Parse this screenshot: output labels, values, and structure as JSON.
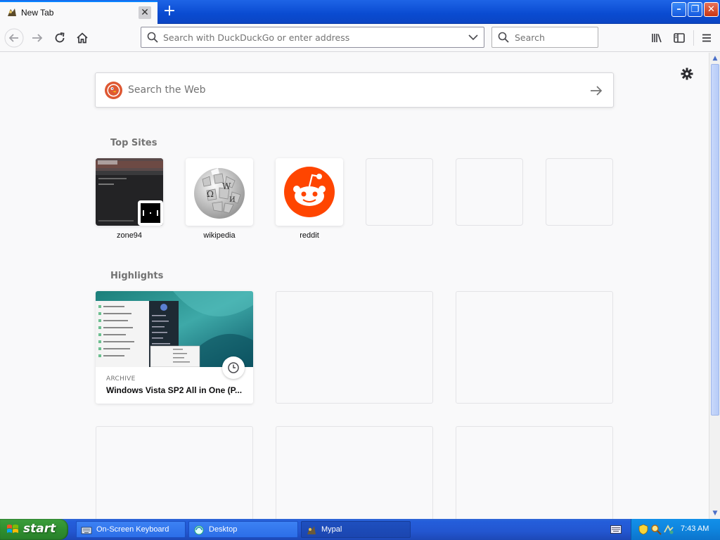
{
  "tab": {
    "title": "New Tab",
    "close": "✕",
    "new_tab": "+"
  },
  "window": {
    "minimize": "–",
    "restore": "❐",
    "close": "✕"
  },
  "navbar": {
    "url_placeholder": "Search with DuckDuckGo or enter address",
    "search_placeholder": "Search"
  },
  "page": {
    "web_search_placeholder": "Search the Web",
    "top_sites_title": "Top Sites",
    "top_sites": [
      {
        "label": "zone94"
      },
      {
        "label": "wikipedia"
      },
      {
        "label": "reddit"
      },
      {
        "label": ""
      },
      {
        "label": ""
      },
      {
        "label": ""
      }
    ],
    "highlights_title": "Highlights",
    "highlights": [
      {
        "context": "ARCHIVE",
        "title": "Windows Vista SP2 All in One (P..."
      }
    ]
  },
  "taskbar": {
    "start_label": "start",
    "tasks": [
      {
        "label": "On-Screen Keyboard"
      },
      {
        "label": "Desktop"
      },
      {
        "label": "Mypal"
      }
    ],
    "clock": "7:43 AM"
  },
  "colors": {
    "accent": "#0a84ff",
    "reddit": "#ff4500",
    "ddg": "#de5833",
    "taskbar": "#245edb",
    "start": "#2f8f2f"
  }
}
